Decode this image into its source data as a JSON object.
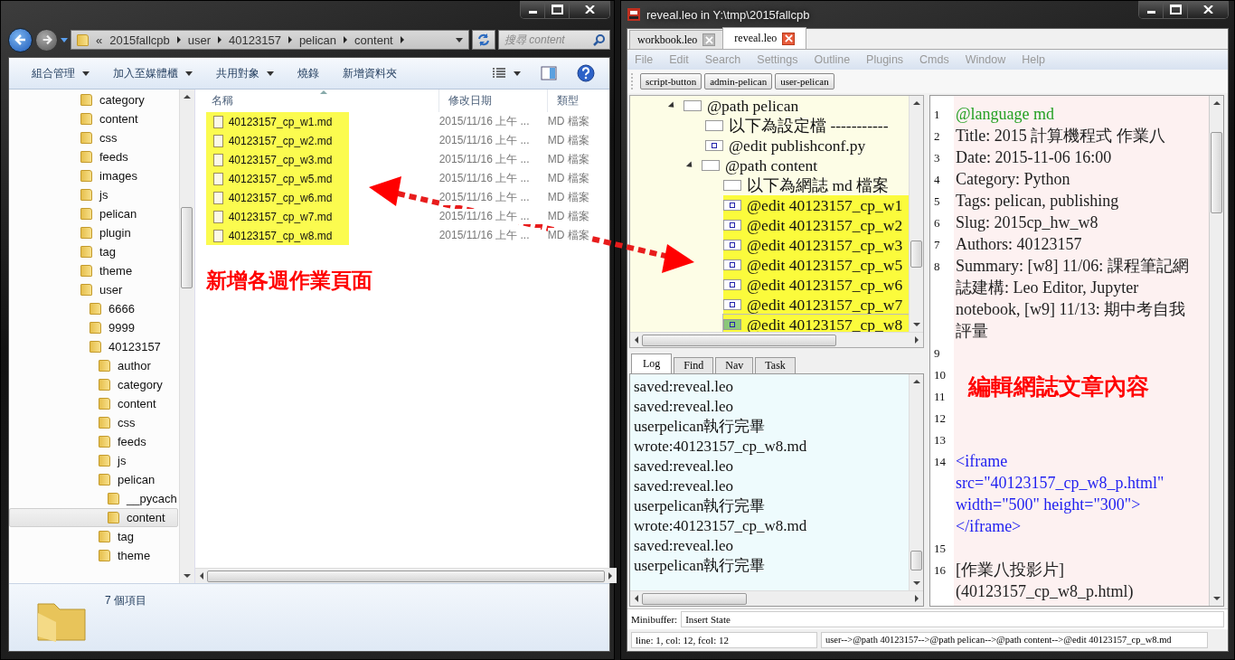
{
  "explorer": {
    "breadcrumb": {
      "overflow": "«",
      "parts": [
        "2015fallcpb",
        "user",
        "40123157",
        "pelican",
        "content"
      ]
    },
    "search": {
      "placeholder": "搜尋 content"
    },
    "toolbar": [
      {
        "label": "組合管理",
        "dropdown": true
      },
      {
        "label": "加入至媒體櫃",
        "dropdown": true
      },
      {
        "label": "共用對象",
        "dropdown": true
      },
      {
        "label": "燒錄",
        "dropdown": false
      },
      {
        "label": "新增資料夾",
        "dropdown": false
      }
    ],
    "tree": [
      {
        "label": "category",
        "selected": false
      },
      {
        "label": "content",
        "selected": false
      },
      {
        "label": "css",
        "selected": false
      },
      {
        "label": "feeds",
        "selected": false
      },
      {
        "label": "images",
        "selected": false
      },
      {
        "label": "js",
        "selected": false
      },
      {
        "label": "pelican",
        "selected": false
      },
      {
        "label": "plugin",
        "selected": false
      },
      {
        "label": "tag",
        "selected": false
      },
      {
        "label": "theme",
        "selected": false
      },
      {
        "label": "user",
        "selected": false,
        "children": [
          {
            "label": "6666",
            "selected": false
          },
          {
            "label": "9999",
            "selected": false
          },
          {
            "label": "40123157",
            "selected": false,
            "children": [
              {
                "label": "author",
                "selected": false
              },
              {
                "label": "category",
                "selected": false
              },
              {
                "label": "content",
                "selected": false
              },
              {
                "label": "css",
                "selected": false
              },
              {
                "label": "feeds",
                "selected": false
              },
              {
                "label": "js",
                "selected": false
              },
              {
                "label": "pelican",
                "selected": false,
                "children": [
                  {
                    "label": "__pycach",
                    "selected": false
                  },
                  {
                    "label": "content",
                    "selected": true
                  }
                ]
              },
              {
                "label": "tag",
                "selected": false
              },
              {
                "label": "theme",
                "selected": false
              }
            ]
          }
        ]
      }
    ],
    "columns": [
      "名稱",
      "修改日期",
      "類型"
    ],
    "files": [
      {
        "name": "40123157_cp_w1.md",
        "date": "2015/11/16 上午 ...",
        "type": "MD 檔案",
        "highlighted": true
      },
      {
        "name": "40123157_cp_w2.md",
        "date": "2015/11/16 上午 ...",
        "type": "MD 檔案",
        "highlighted": true
      },
      {
        "name": "40123157_cp_w3.md",
        "date": "2015/11/16 上午 ...",
        "type": "MD 檔案",
        "highlighted": true
      },
      {
        "name": "40123157_cp_w5.md",
        "date": "2015/11/16 上午 ...",
        "type": "MD 檔案",
        "highlighted": true
      },
      {
        "name": "40123157_cp_w6.md",
        "date": "2015/11/16 上午 ...",
        "type": "MD 檔案",
        "highlighted": true
      },
      {
        "name": "40123157_cp_w7.md",
        "date": "2015/11/16 上午 ...",
        "type": "MD 檔案",
        "highlighted": true
      },
      {
        "name": "40123157_cp_w8.md",
        "date": "2015/11/16 上午 ...",
        "type": "MD 檔案",
        "highlighted": true
      }
    ],
    "annotation": "新增各週作業頁面",
    "status": "7 個項目"
  },
  "leo": {
    "title": "reveal.leo in Y:\\tmp\\2015fallcpb",
    "tabs": [
      {
        "label": "workbook.leo",
        "selected": false
      },
      {
        "label": "reveal.leo",
        "selected": true
      }
    ],
    "menu": [
      "File",
      "Edit",
      "Search",
      "Settings",
      "Outline",
      "Plugins",
      "Cmds",
      "Window",
      "Help"
    ],
    "buttons": [
      "script-button",
      "admin-pelican",
      "user-pelican"
    ],
    "outline": [
      {
        "label": "@path pelican",
        "kind": "note",
        "expanded": true,
        "highlighted": false,
        "selected": false,
        "children": [
          {
            "label": "以下為設定檔 -----------",
            "kind": "note",
            "highlighted": false,
            "selected": false
          },
          {
            "label": "@edit publishconf.py",
            "kind": "edit",
            "highlighted": false,
            "selected": false
          },
          {
            "label": "@path content",
            "kind": "note",
            "expanded": true,
            "highlighted": false,
            "selected": false,
            "children": [
              {
                "label": "以下為網誌 md 檔案",
                "kind": "note",
                "highlighted": false,
                "selected": false
              },
              {
                "label": "@edit 40123157_cp_w1",
                "kind": "edit",
                "highlighted": true,
                "selected": false
              },
              {
                "label": "@edit 40123157_cp_w2",
                "kind": "edit",
                "highlighted": true,
                "selected": false
              },
              {
                "label": "@edit 40123157_cp_w3",
                "kind": "edit",
                "highlighted": true,
                "selected": false
              },
              {
                "label": "@edit 40123157_cp_w5",
                "kind": "edit",
                "highlighted": true,
                "selected": false
              },
              {
                "label": "@edit 40123157_cp_w6",
                "kind": "edit",
                "highlighted": true,
                "selected": false
              },
              {
                "label": "@edit 40123157_cp_w7",
                "kind": "edit",
                "highlighted": true,
                "selected": false
              },
              {
                "label": "@edit 40123157_cp_w8",
                "kind": "edit",
                "highlighted": true,
                "selected": true
              }
            ]
          }
        ]
      }
    ],
    "log_tabs": [
      {
        "label": "Log",
        "selected": true
      },
      {
        "label": "Find",
        "selected": false
      },
      {
        "label": "Nav",
        "selected": false
      },
      {
        "label": "Task",
        "selected": false
      }
    ],
    "log": [
      "saved:reveal.leo",
      "saved:reveal.leo",
      "userpelican執行完畢",
      "wrote:40123157_cp_w8.md",
      "saved:reveal.leo",
      "saved:reveal.leo",
      "userpelican執行完畢",
      "wrote:40123157_cp_w8.md",
      "saved:reveal.leo",
      "userpelican執行完畢"
    ],
    "body": [
      {
        "num": "1",
        "text": "@language md",
        "kind": "directive"
      },
      {
        "num": "2",
        "text": "Title: 2015 計算機程式 作業八",
        "kind": "plain"
      },
      {
        "num": "3",
        "text": "Date: 2015-11-06 16:00",
        "kind": "plain"
      },
      {
        "num": "4",
        "text": "Category: Python",
        "kind": "plain"
      },
      {
        "num": "5",
        "text": "Tags: pelican, publishing",
        "kind": "plain"
      },
      {
        "num": "6",
        "text": "Slug: 2015cp_hw_w8",
        "kind": "plain"
      },
      {
        "num": "7",
        "text": "Authors: 40123157",
        "kind": "plain"
      },
      {
        "num": "8",
        "text": "Summary: [w8] 11/06: 課程筆記網誌建構: Leo Editor, Jupyter notebook, [w9] 11/13: 期中考自我評量",
        "kind": "plain"
      },
      {
        "num": "9"
      },
      {
        "num": "10"
      },
      {
        "num": "11"
      },
      {
        "num": "12"
      },
      {
        "num": "13"
      },
      {
        "num": "14",
        "text": "<iframe src=\"40123157_cp_w8_p.html\" width=\"500\" height=\"300\"></iframe>",
        "kind": "html"
      },
      {
        "num": "15"
      },
      {
        "num": "16",
        "text": "[作業八投影片] (40123157_cp_w8_p.html)",
        "kind": "plain"
      }
    ],
    "annotation": "編輯網誌文章內容",
    "minibuffer": {
      "label": "Minibuffer:",
      "value": "Insert State"
    },
    "status": {
      "position": "line: 1, col: 12, fcol: 12",
      "path": "user-->@path 40123157-->@path pelican-->@path content-->@edit 40123157_cp_w8.md"
    }
  }
}
